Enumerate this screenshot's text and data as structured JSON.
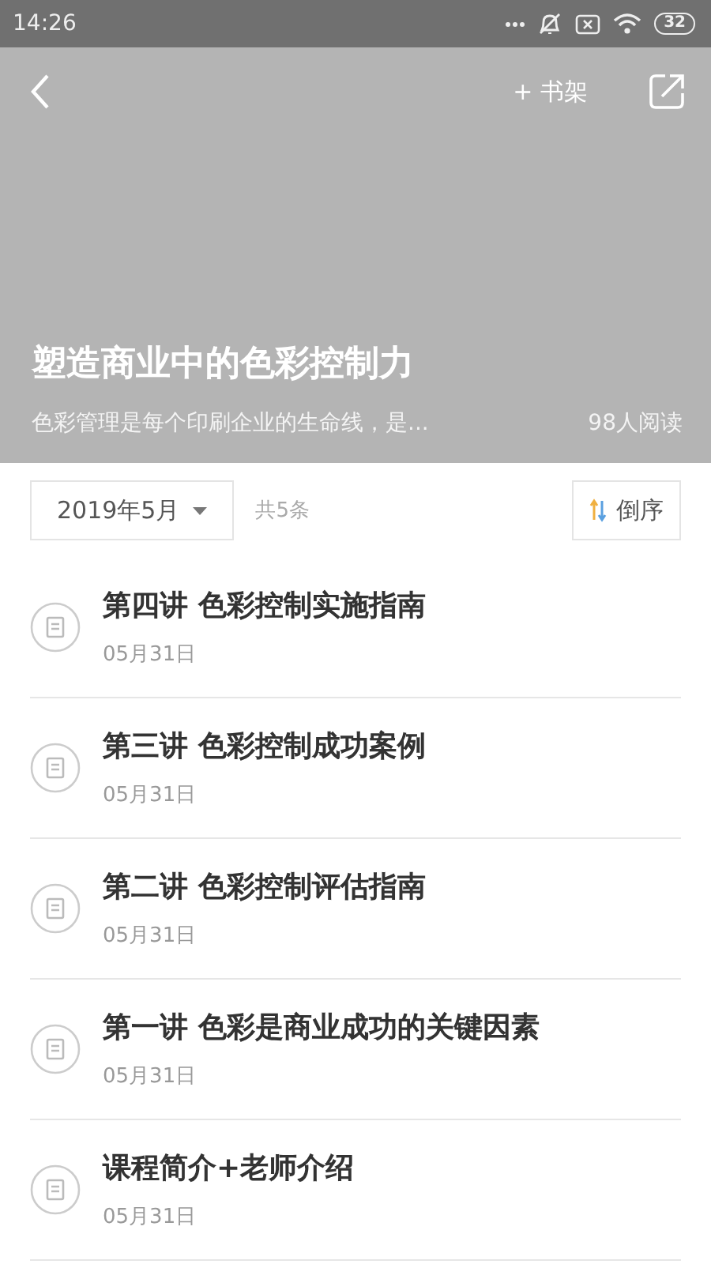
{
  "status_bar": {
    "time": "14:26",
    "battery": "32"
  },
  "header": {
    "shelf_button": "+ 书架",
    "title": "塑造商业中的色彩控制力",
    "description": "色彩管理是每个印刷企业的生命线，是...",
    "readers": "98人阅读"
  },
  "filter": {
    "month": "2019年5月",
    "count": "共5条",
    "sort_button": "倒序"
  },
  "lessons": [
    {
      "title": "第四讲  色彩控制实施指南",
      "date": "05月31日"
    },
    {
      "title": "第三讲  色彩控制成功案例",
      "date": "05月31日"
    },
    {
      "title": "第二讲  色彩控制评估指南",
      "date": "05月31日"
    },
    {
      "title": "第一讲  色彩是商业成功的关键因素",
      "date": "05月31日"
    },
    {
      "title": "课程简介+老师介绍",
      "date": "05月31日"
    }
  ]
}
